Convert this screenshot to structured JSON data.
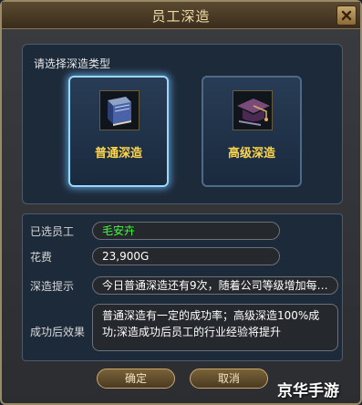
{
  "dialog": {
    "title": "员工深造",
    "close_icon": "close-icon"
  },
  "type_panel": {
    "label": "请选择深造类型",
    "options": [
      {
        "label": "普通深造",
        "icon": "book-icon",
        "selected": true
      },
      {
        "label": "高级深造",
        "icon": "mortarboard-icon",
        "selected": false
      }
    ]
  },
  "info": {
    "employee_label": "已选员工",
    "employee_value": "毛安卉",
    "cost_label": "花费",
    "cost_value": "23,900G",
    "hint_label": "深造提示",
    "hint_value": "今日普通深造还有9次，随着公司等级增加每…",
    "effect_label": "成功后效果",
    "effect_value": "普通深造有一定的成功率；高级深造100%成功;深造成功后员工的行业经验将提升"
  },
  "buttons": {
    "confirm": "确定",
    "cancel": "取消"
  },
  "watermark": "京华手游",
  "colors": {
    "selected_glow": "#9ad8ff",
    "option_label": "#ffd64a",
    "employee_name": "#3cff3c"
  }
}
